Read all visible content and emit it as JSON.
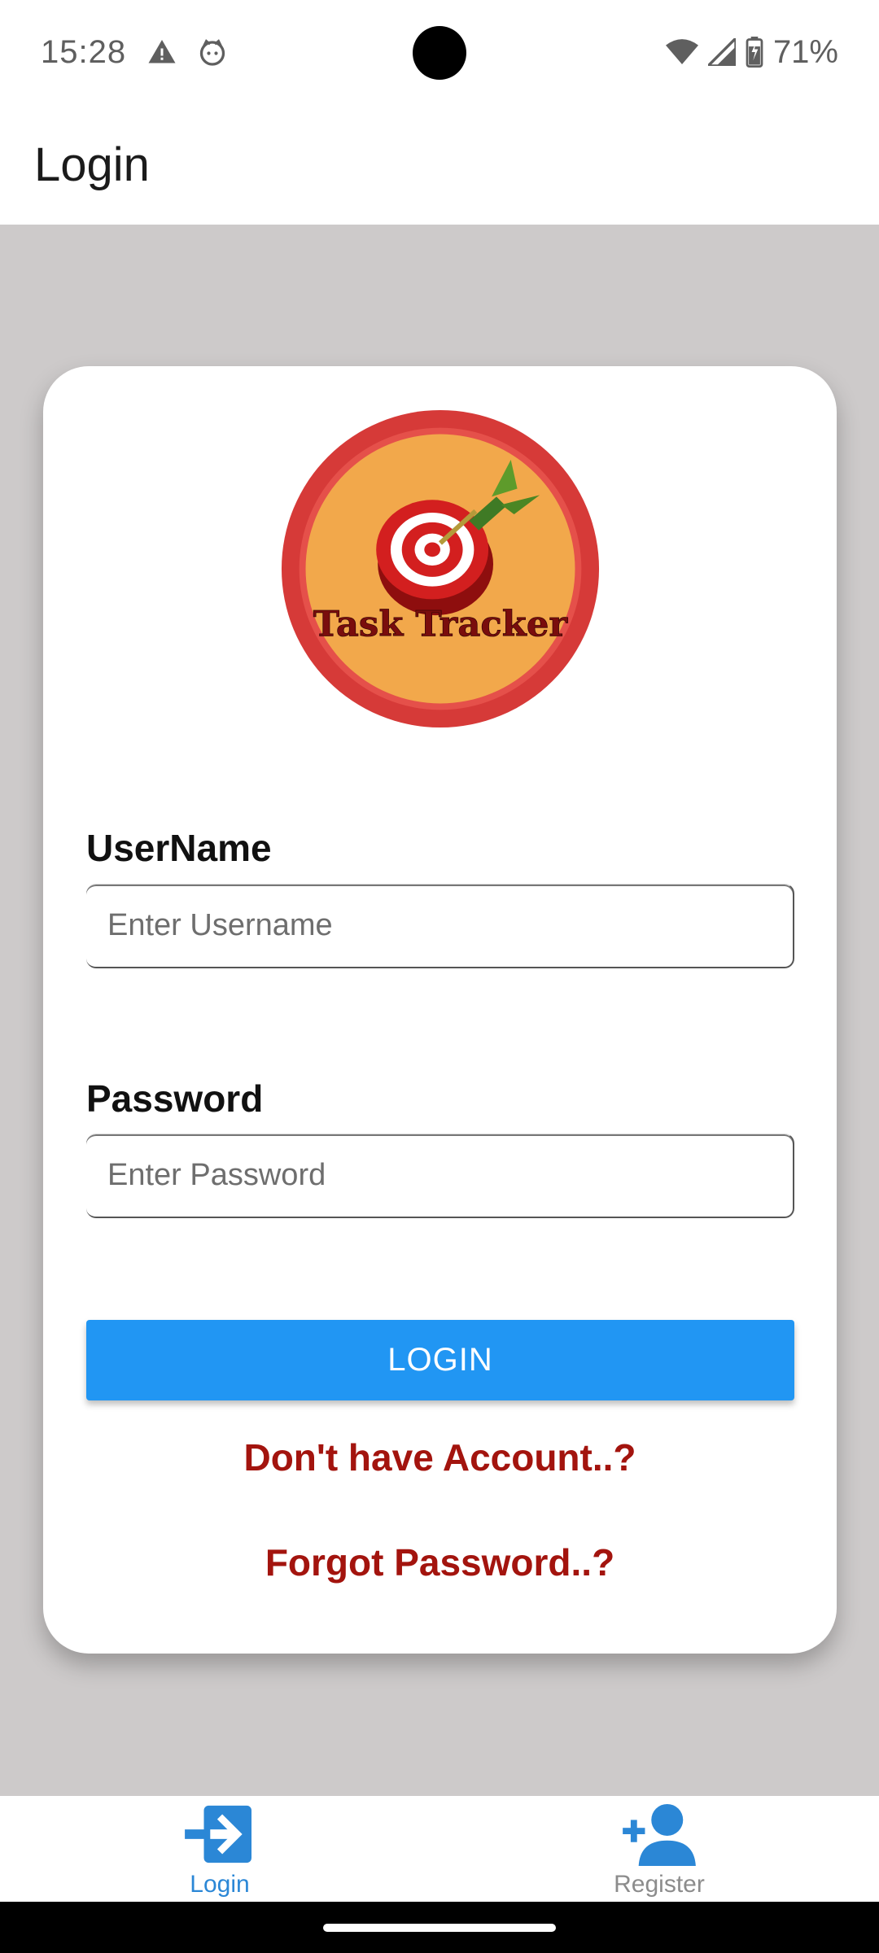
{
  "status_bar": {
    "time": "15:28",
    "battery": "71%",
    "icons": [
      "warning-icon",
      "cat-face-icon",
      "wifi-icon",
      "signal-icon",
      "battery-icon"
    ]
  },
  "app_bar": {
    "title": "Login"
  },
  "logo": {
    "text": "Task Tracker"
  },
  "form": {
    "username_label": "UserName",
    "username_placeholder": "Enter Username",
    "username_value": "",
    "password_label": "Password",
    "password_placeholder": "Enter Password",
    "password_value": "",
    "login_button": "LOGIN",
    "register_link": "Don't have Account..?",
    "forgot_link": "Forgot Password..?"
  },
  "bottom_nav": {
    "items": [
      {
        "label": "Login",
        "icon": "login-icon",
        "active": true
      },
      {
        "label": "Register",
        "icon": "add-user-icon",
        "active": false
      }
    ]
  },
  "colors": {
    "primary": "#2196f3",
    "link": "#a3140e",
    "background": "#cdcaca",
    "nav_active": "#2b87d6"
  }
}
